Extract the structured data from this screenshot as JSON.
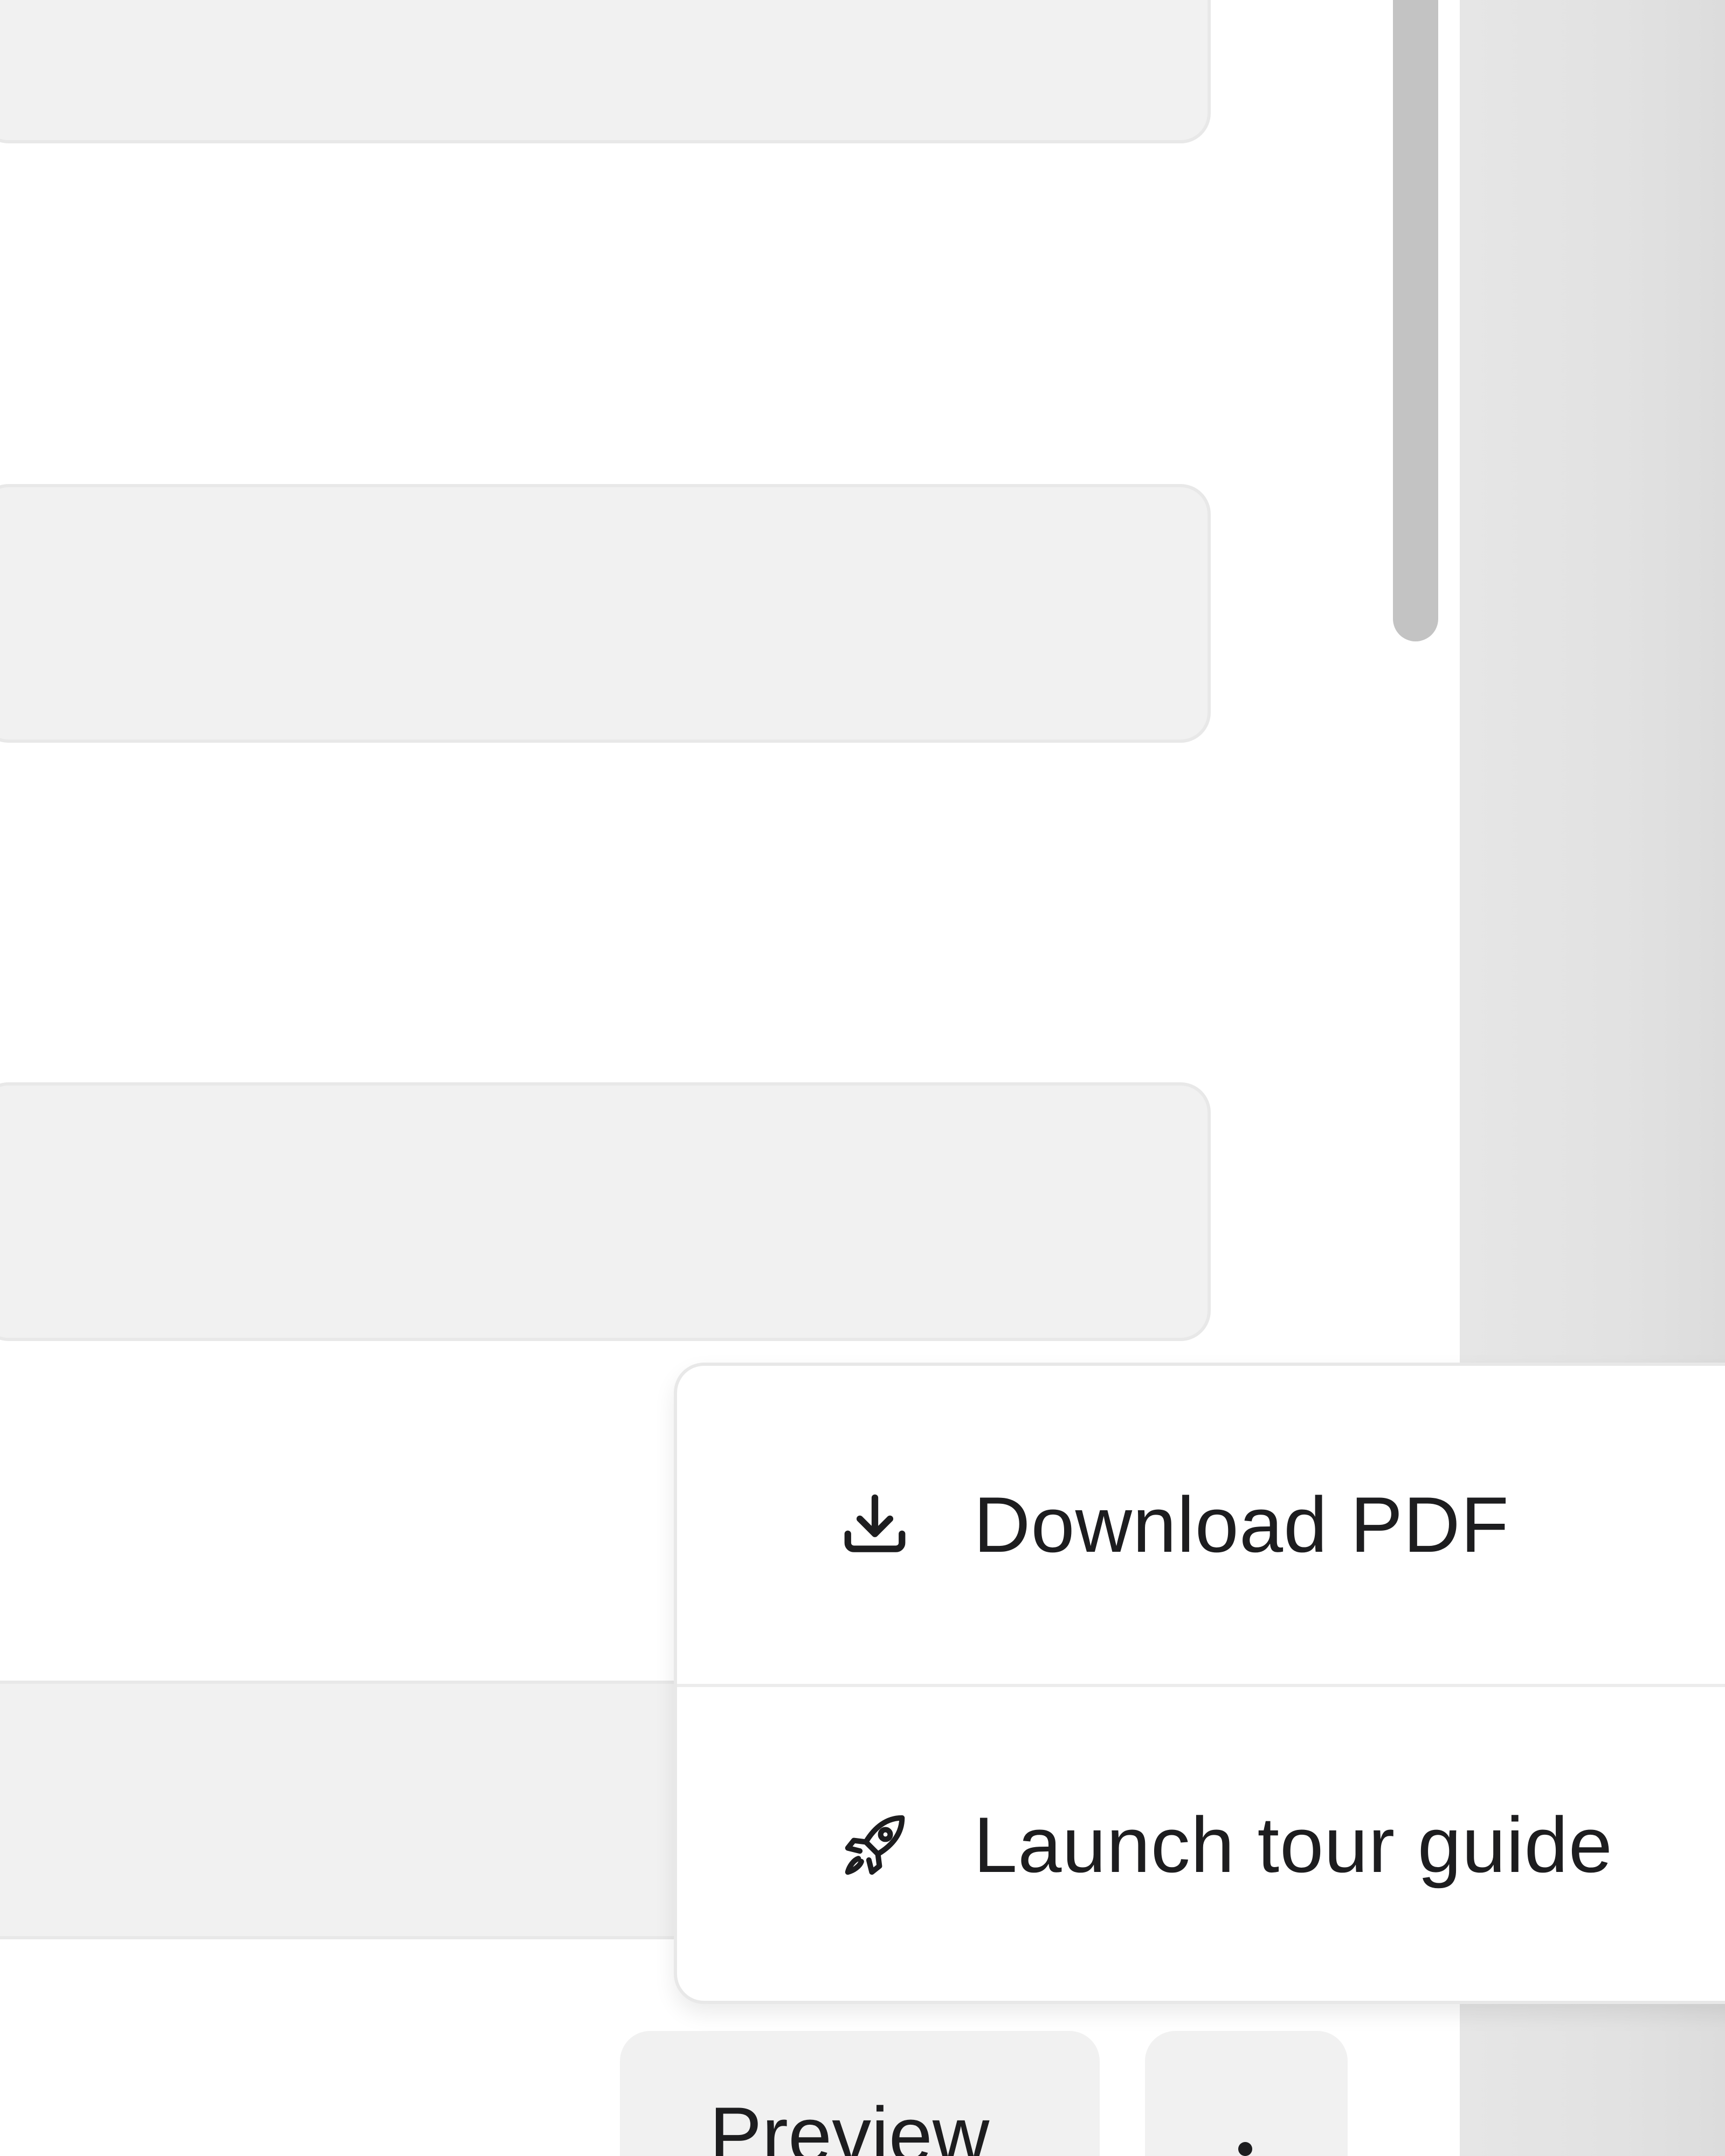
{
  "menu": {
    "items": [
      {
        "icon": "download-icon",
        "label": "Download PDF"
      },
      {
        "icon": "rocket-icon",
        "label": "Launch tour guide"
      }
    ]
  },
  "footer": {
    "preview_label": "Preview",
    "more_icon": "more-vertical-icon"
  },
  "colors": {
    "field_bg": "#f1f1f1",
    "text": "#1d1d1f",
    "side_strip": "#e2e2e2"
  }
}
